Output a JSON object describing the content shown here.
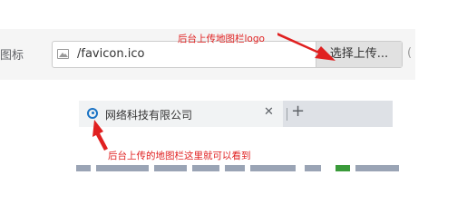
{
  "form": {
    "field_label": "图标",
    "file_name": "/favicon.ico",
    "upload_button": "选择上传...",
    "edge_glyph": "("
  },
  "annotations": {
    "top_note": "后台上传地图栏logo",
    "bottom_note": "后台上传的地图栏这里就可以看到"
  },
  "browser": {
    "tab_title": "网络科技有限公司",
    "close_glyph": "✕",
    "new_tab_glyph": "+"
  },
  "colors": {
    "annotation": "#e02020",
    "favicon": "#1a73c4"
  }
}
